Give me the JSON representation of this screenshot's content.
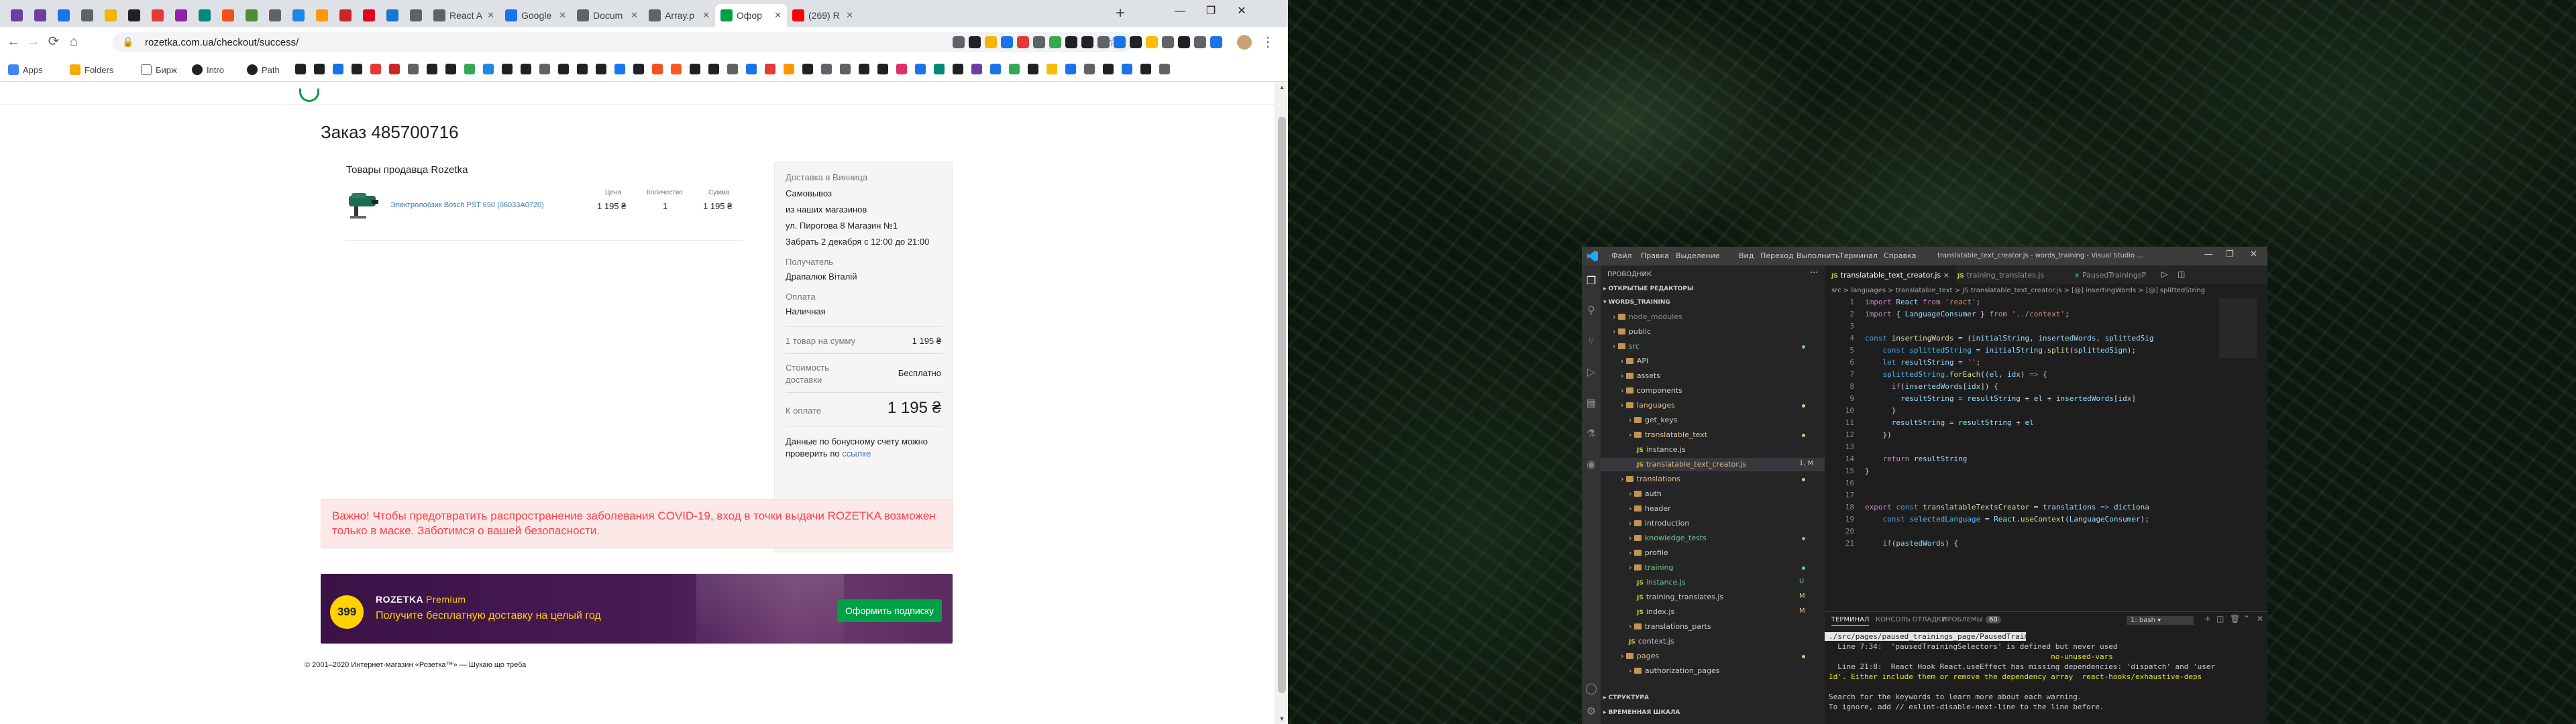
{
  "browser": {
    "tabs": [
      {
        "label": "",
        "color": "#6b3fa0"
      },
      {
        "label": "",
        "color": "#6b3fa0"
      },
      {
        "label": "",
        "color": "#1a73e8"
      },
      {
        "label": "",
        "color": "#5f6368"
      },
      {
        "label": "",
        "color": "#f4b400"
      },
      {
        "label": "",
        "color": "#202124"
      },
      {
        "label": "",
        "color": "#e53935"
      },
      {
        "label": "",
        "color": "#8e24aa"
      },
      {
        "label": "",
        "color": "#00897b"
      },
      {
        "label": "",
        "color": "#f4511e"
      },
      {
        "label": "",
        "color": "#4e8b3a"
      },
      {
        "label": "",
        "color": "#5f6368"
      },
      {
        "label": "",
        "color": "#1e88e5"
      },
      {
        "label": "",
        "color": "#ff9800"
      },
      {
        "label": "",
        "color": "#c62828"
      },
      {
        "label": "",
        "color": "#e60023"
      },
      {
        "label": "",
        "color": "#1976d2"
      },
      {
        "label": "",
        "color": "#5f6368"
      },
      {
        "label": "React A",
        "color": "#5f6368"
      },
      {
        "label": "Google",
        "color": "#1a73e8"
      },
      {
        "label": "Docum",
        "color": "#5f6368"
      },
      {
        "label": "Array.p",
        "color": "#5f6368"
      },
      {
        "label": "Офор",
        "color": "#00a046"
      },
      {
        "label": "(269) R",
        "color": "#ff0000"
      }
    ],
    "url": "rozetka.com.ua/checkout/success/",
    "bookmarks": [
      {
        "label": "Apps",
        "color": "#4285f4"
      },
      {
        "label": "Folders",
        "color": "#f9ab00"
      },
      {
        "label": "Бирж",
        "color": "#5f6368"
      },
      {
        "label": "Intro",
        "color": "#202124"
      },
      {
        "label": "Path",
        "color": "#202124"
      }
    ]
  },
  "order": {
    "title": "Заказ 485700716",
    "seller_label": "Товары продавца Rozetka",
    "product_name": "Электролобзик Bosch PST 650 (06033A0720)",
    "col_price": "Цена",
    "col_qty": "Количество",
    "col_sum": "Сумма",
    "price": "1 195 ₴",
    "qty": "1",
    "sum": "1 195 ₴"
  },
  "summary": {
    "delivery_title": "Доставка в Винница",
    "delivery_method": "Самовывоз",
    "delivery_from": "из наших магазинов",
    "address": "ул. Пирогова 8 Магазин №1",
    "pickup": "Забрать 2 декабря с 12:00  до  21:00",
    "recipient_label": "Получатель",
    "recipient": "Драпалюк Віталій",
    "payment_label": "Оплата",
    "payment": "Наличная",
    "items_label": "1 товар на сумму",
    "items_sum": "1 195 ₴",
    "shipping_label_1": "Стоимость",
    "shipping_label_2": "доставки",
    "shipping_value": "Бесплатно",
    "total_label": "К оплате",
    "total": "1 195 ₴",
    "bonus_1": "Данные по бонусному счету можно",
    "bonus_2": "проверить по",
    "bonus_link": "ссылке"
  },
  "notice": "Важно! Чтобы предотвратить распространение заболевания COVID-19, вход в точки выдачи ROZETKA возможен только в маске. Заботимся о вашей безопасности.",
  "banner": {
    "price": "399",
    "logo": "ROZETKA",
    "logo_suffix": "Premium",
    "text": "Получите бесплатную доставку на целый год",
    "button": "Оформить подписку"
  },
  "footer": "© 2001–2020 Интернет-магазин «Розетка™» — Шукаю що треба",
  "vscode": {
    "menu": [
      "Файл",
      "Правка",
      "Выделение",
      "Вид",
      "Переход",
      "Выполнить",
      "Терминал",
      "Справка"
    ],
    "title": "translatable_text_creator.js - words_training - Visual Studio ...",
    "explorer_title": "ПРОВОДНИК",
    "open_editors": "ОТКРЫТЫЕ РЕДАКТОРЫ",
    "workspace": "WORDS_TRAINING",
    "tree": [
      {
        "label": "node_modules",
        "depth": 1,
        "type": "folder",
        "dim": true
      },
      {
        "label": "public",
        "depth": 1,
        "type": "folder"
      },
      {
        "label": "src",
        "depth": 1,
        "type": "folder",
        "color": "#73c991"
      },
      {
        "label": "API",
        "depth": 2,
        "type": "folder"
      },
      {
        "label": "assets",
        "depth": 2,
        "type": "folder"
      },
      {
        "label": "components",
        "depth": 2,
        "type": "folder"
      },
      {
        "label": "languages",
        "depth": 2,
        "type": "folder",
        "color": "#e2c08d"
      },
      {
        "label": "get_keys",
        "depth": 3,
        "type": "folder"
      },
      {
        "label": "translatable_text",
        "depth": 3,
        "type": "folder",
        "color": "#e2c08d"
      },
      {
        "label": "instance.js",
        "depth": 4,
        "type": "js"
      },
      {
        "label": "translatable_text_creator.js",
        "depth": 4,
        "type": "js",
        "color": "#e2c08d",
        "badge": "1, M"
      },
      {
        "label": "translations",
        "depth": 2,
        "type": "folder",
        "color": "#e2c08d"
      },
      {
        "label": "auth",
        "depth": 3,
        "type": "folder"
      },
      {
        "label": "header",
        "depth": 3,
        "type": "folder"
      },
      {
        "label": "introduction",
        "depth": 3,
        "type": "folder"
      },
      {
        "label": "knowledge_tests",
        "depth": 3,
        "type": "folder",
        "color": "#73c991"
      },
      {
        "label": "profile",
        "depth": 3,
        "type": "folder"
      },
      {
        "label": "training",
        "depth": 3,
        "type": "folder",
        "color": "#73c991"
      },
      {
        "label": "instance.js",
        "depth": 4,
        "type": "js",
        "color": "#73c991",
        "badge": "U"
      },
      {
        "label": "training_translates.js",
        "depth": 4,
        "type": "js",
        "badge": "M"
      },
      {
        "label": "index.js",
        "depth": 4,
        "type": "js",
        "badge": "M"
      },
      {
        "label": "translations_parts",
        "depth": 3,
        "type": "folder"
      },
      {
        "label": "context.js",
        "depth": 3,
        "type": "js"
      },
      {
        "label": "pages",
        "depth": 2,
        "type": "folder",
        "color": "#e2c08d"
      },
      {
        "label": "authorization_pages",
        "depth": 3,
        "type": "folder"
      }
    ],
    "structure": "СТРУКТУРА",
    "timeline": "ВРЕМЕННАЯ ШКАЛА",
    "tabs": [
      "translatable_text_creator.js",
      "training_translates.js",
      "PausedTrainingsP"
    ],
    "breadcrumb": "src > languages > translatable_text > JS translatable_text_creator.js > [@] insertingWords > [@] splittedString",
    "code_lines": [
      {
        "n": "1",
        "html": "<span class='kp'>import</span> <span class='vr'>React</span> <span class='kp'>from</span> <span class='st'>'react'</span>;"
      },
      {
        "n": "2",
        "html": "<span class='kp'>import</span> { <span class='vr'>LanguageConsumer</span> } <span class='kp'>from</span> <span class='st'>'../context'</span>;"
      },
      {
        "n": "3",
        "html": ""
      },
      {
        "n": "4",
        "html": "<span class='kw'>const</span> <span class='fn'>insertingWords</span> = (<span class='vr'>initialString</span>, <span class='vr'>insertedWords</span>, <span class='vr'>splittedSig</span>"
      },
      {
        "n": "5",
        "html": "    <span class='kw'>const</span> <span class='ct'>splittedString</span> = <span class='vr'>initialString</span>.<span class='fn'>split</span>(<span class='vr'>splittedSign</span>);"
      },
      {
        "n": "6",
        "html": "    <span class='kw'>let</span> <span class='vr'>resultString</span> = <span class='st'>''</span>;"
      },
      {
        "n": "7",
        "html": "    <span class='ct'>splittedString</span>.<span class='fn'>forEach</span>((<span class='vr'>el</span>, <span class='vr'>idx</span>) <span class='kw'>=&gt;</span> {"
      },
      {
        "n": "8",
        "html": "      <span class='kp'>if</span>(<span class='vr'>insertedWords</span>[<span class='vr'>idx</span>]) {"
      },
      {
        "n": "9",
        "html": "        <span class='vr'>resultString</span> = <span class='vr'>resultString</span> + <span class='vr'>el</span> + <span class='vr'>insertedWords</span>[<span class='vr'>idx</span>]"
      },
      {
        "n": "10",
        "html": "      }"
      },
      {
        "n": "11",
        "html": "      <span class='vr'>resultString</span> = <span class='vr'>resultString</span> + <span class='vr'>el</span>"
      },
      {
        "n": "12",
        "html": "    })"
      },
      {
        "n": "13",
        "html": ""
      },
      {
        "n": "14",
        "html": "    <span class='kp'>return</span> <span class='vr'>resultString</span>"
      },
      {
        "n": "15",
        "html": "}"
      },
      {
        "n": "16",
        "html": ""
      },
      {
        "n": "17",
        "html": ""
      },
      {
        "n": "18",
        "html": "<span class='kp'>export</span> <span class='kw'>const</span> <span class='fn'>translatableTextsCreator</span> = <span class='vr'>translations</span> <span class='kw'>=&gt;</span> <span class='vr'>dictiona</span>"
      },
      {
        "n": "19",
        "html": "    <span class='kw'>const</span> <span class='ct'>selectedLanguage</span> = <span class='vr'>React</span>.<span class='fn'>useContext</span>(<span class='vr'>LanguageConsumer</span>);"
      },
      {
        "n": "20",
        "html": ""
      },
      {
        "n": "21",
        "html": "    <span class='kp'>if</span>(<span class='vr'>pastedWords</span>) {"
      }
    ],
    "panel_tabs": [
      "ТЕРМИНАЛ",
      "КОНСОЛЬ ОТЛАДКИ",
      "ПРОБЛЕМЫ",
      "60"
    ],
    "terminal_select": "1: bash",
    "terminal_lines": [
      "./src/pages/paused_trainings_page/PausedTrainingsPage.jsx",
      "  Line 7:34:  'pausedTrainingSelectors' is defined but never used",
      "                                                  no-unused-vars",
      "  Line 21:8:  React Hook React.useEffect has missing dependencies: 'dispatch' and 'user",
      "Id'. Either include them or remove the dependency array  react-hooks/exhaustive-deps",
      "",
      "Search for the keywords to learn more about each warning.",
      "To ignore, add // eslint-disable-next-line to the line before."
    ]
  }
}
